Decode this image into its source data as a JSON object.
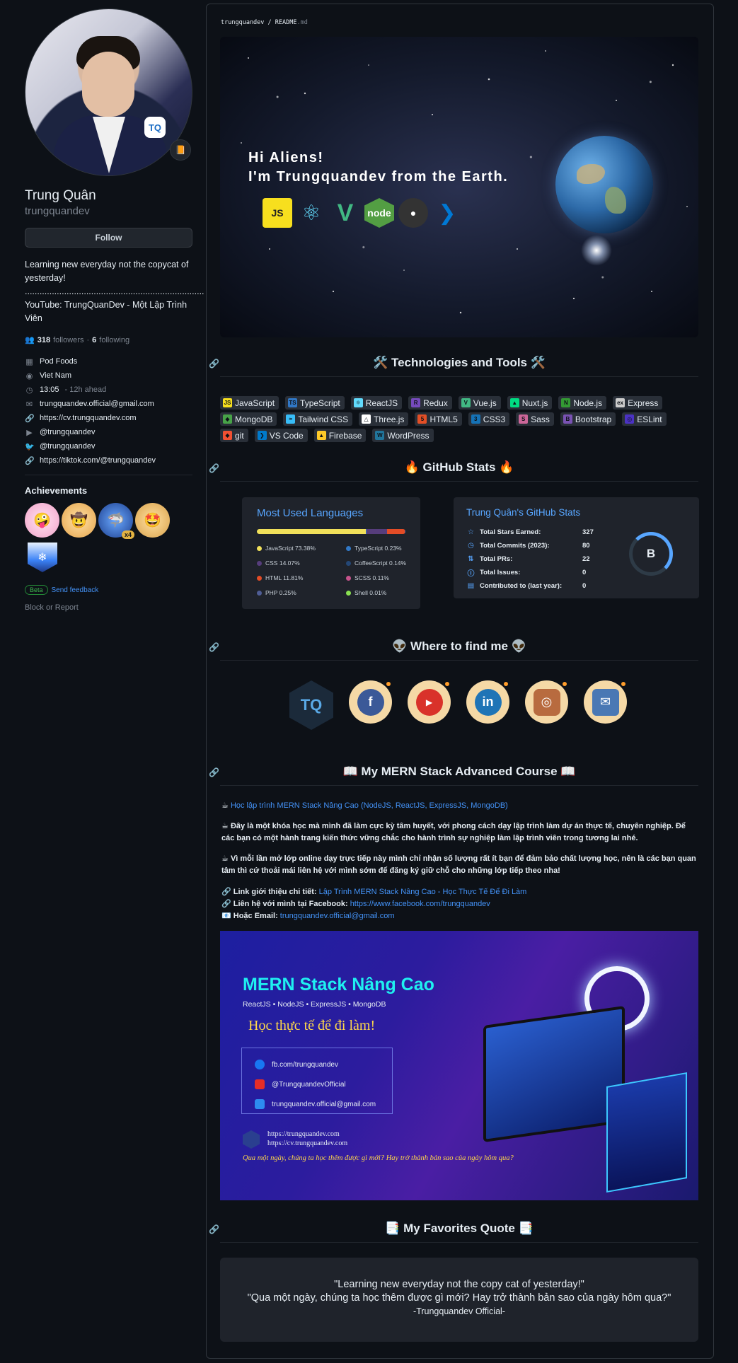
{
  "profile": {
    "fullname": "Trung Quân",
    "username": "trungquandev",
    "follow_label": "Follow",
    "bio": "Learning new everyday not the copycat of yesterday! ......................................................................... YouTube: TrungQuanDev - Một Lập Trình Viên",
    "followers_count": "318",
    "followers_label": "followers",
    "following_count": "6",
    "following_label": "following",
    "details": {
      "company": "Pod Foods",
      "location": "Viet Nam",
      "time": "13:05",
      "time_note": "- 12h ahead",
      "email": "trungquandev.official@gmail.com",
      "website": "https://cv.trungquandev.com",
      "youtube": "@trungquandev",
      "twitter": "@trungquandev",
      "tiktok": "https://tiktok.com/@trungquandev"
    },
    "achievements_title": "Achievements",
    "achievement_count": "x4",
    "beta_label": "Beta",
    "feedback_label": "Send feedback",
    "block_label": "Block or Report"
  },
  "readme": {
    "path_user": "trungquandev",
    "path_sep": " / ",
    "path_file": "README",
    "path_ext": ".md",
    "hero_line1": "Hi Aliens!",
    "hero_line2": "I'm Trungquandev from the Earth.",
    "sections": {
      "tech": "🛠️ Technologies and Tools 🛠️",
      "stats": "🔥 GitHub Stats 🔥",
      "find": "👽 Where to find me 👽",
      "course": "📖 My MERN Stack Advanced Course 📖",
      "quote": "📑 My Favorites Quote 📑"
    },
    "tags": [
      {
        "label": "JavaScript",
        "color": "#f7df1e",
        "ico": "JS"
      },
      {
        "label": "TypeScript",
        "color": "#3178c6",
        "ico": "TS"
      },
      {
        "label": "ReactJS",
        "color": "#61dafb",
        "ico": "⚛"
      },
      {
        "label": "Redux",
        "color": "#764abc",
        "ico": "R"
      },
      {
        "label": "Vue.js",
        "color": "#41b883",
        "ico": "V"
      },
      {
        "label": "Nuxt.js",
        "color": "#00dc82",
        "ico": "▲"
      },
      {
        "label": "Node.js",
        "color": "#339933",
        "ico": "N"
      },
      {
        "label": "Express",
        "color": "#cccccc",
        "ico": "ex"
      },
      {
        "label": "MongoDB",
        "color": "#47a248",
        "ico": "◆"
      },
      {
        "label": "Tailwind CSS",
        "color": "#38bdf8",
        "ico": "≈"
      },
      {
        "label": "Three.js",
        "color": "#ffffff",
        "ico": "△"
      },
      {
        "label": "HTML5",
        "color": "#e34f26",
        "ico": "5"
      },
      {
        "label": "CSS3",
        "color": "#1572b6",
        "ico": "3"
      },
      {
        "label": "Sass",
        "color": "#cc6699",
        "ico": "S"
      },
      {
        "label": "Bootstrap",
        "color": "#7952b3",
        "ico": "B"
      },
      {
        "label": "ESLint",
        "color": "#4b32c3",
        "ico": "◎"
      },
      {
        "label": "git",
        "color": "#f05032",
        "ico": "◆"
      },
      {
        "label": "VS Code",
        "color": "#007acc",
        "ico": "❯"
      },
      {
        "label": "Firebase",
        "color": "#ffca28",
        "ico": "▲"
      },
      {
        "label": "WordPress",
        "color": "#21759b",
        "ico": "W"
      }
    ],
    "languages": {
      "title": "Most Used Languages",
      "items": [
        {
          "label": "JavaScript 73.38%",
          "color": "#f1e05a",
          "value": 73.38
        },
        {
          "label": "TypeScript 0.23%",
          "color": "#3178c6",
          "value": 0.23
        },
        {
          "label": "CSS 14.07%",
          "color": "#563d7c",
          "value": 14.07
        },
        {
          "label": "CoffeeScript 0.14%",
          "color": "#244776",
          "value": 0.14
        },
        {
          "label": "HTML 11.81%",
          "color": "#e34c26",
          "value": 11.81
        },
        {
          "label": "SCSS 0.11%",
          "color": "#c6538c",
          "value": 0.11
        },
        {
          "label": "PHP 0.25%",
          "color": "#4f5d95",
          "value": 0.25
        },
        {
          "label": "Shell 0.01%",
          "color": "#89e051",
          "value": 0.01
        }
      ]
    },
    "stats": {
      "title": "Trung Quân's GitHub Stats",
      "rows": [
        {
          "label": "Total Stars Earned:",
          "value": "327",
          "icon": "☆"
        },
        {
          "label": "Total Commits (2023):",
          "value": "80",
          "icon": "◷"
        },
        {
          "label": "Total PRs:",
          "value": "22",
          "icon": "⇅"
        },
        {
          "label": "Total Issues:",
          "value": "0",
          "icon": "ⓘ"
        },
        {
          "label": "Contributed to (last year):",
          "value": "0",
          "icon": "▤"
        }
      ],
      "rank": "B"
    },
    "course": {
      "link1": "Học lập trình MERN Stack Nâng Cao (NodeJS, ReactJS, ExpressJS, MongoDB)",
      "p1": "Đây là một khóa học mà mình đã làm cực kỳ tâm huyết, với phong cách dạy lập trình làm dự án thực tế, chuyên nghiệp. Để các bạn có một hành trang kiến thức vững chắc cho hành trình sự nghiệp làm lập trình viên trong tương lai nhé.",
      "p2": "Vì mỗi lần mở lớp online dạy trực tiếp này mình chỉ nhận số lượng rất ít bạn để đảm bảo chất lượng học, nên là các bạn quan tâm thì cứ thoải mái liên hệ với mình sớm để đăng ký giữ chỗ cho những lớp tiếp theo nha!",
      "intro_label": "Link giới thiệu chi tiết:",
      "intro_link": "Lập Trình MERN Stack Nâng Cao - Học Thực Tế Để Đi Làm",
      "fb_label": "Liên hệ với mình tại Facebook:",
      "fb_link": "https://www.facebook.com/trungquandev",
      "email_label": "Hoặc Email:",
      "email_link": "trungquandev.official@gmail.com"
    },
    "banner": {
      "title": "MERN Stack Nâng Cao",
      "subtitle": "ReactJS • NodeJS • ExpressJS • MongoDB",
      "headline": "Học thực tế để đi làm!",
      "fb": "fb.com/trungquandev",
      "yt": "@TrungquandevOfficial",
      "mail": "trungquandev.official@gmail.com",
      "site1": "https://trungquandev.com",
      "site2": "https://cv.trungquandev.com",
      "quote": "Qua một ngày, chúng ta học thêm được gì mới? Hay trở thành bản sao của ngày hôm qua?"
    },
    "quote": {
      "line1": "\"Learning new everyday not the copy cat of yesterday!\"",
      "line2": "\"Qua một ngày, chúng ta học thêm được gì mới? Hay trở thành bản sao của ngày hôm qua?\"",
      "author": "-Trungquandev Official-"
    }
  }
}
